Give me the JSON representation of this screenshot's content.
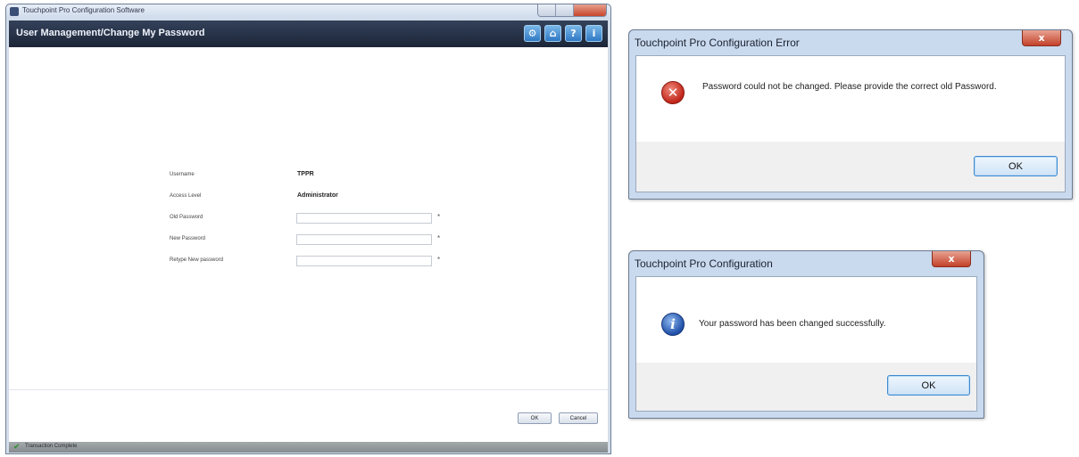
{
  "main_window": {
    "title": "Touchpoint Pro Configuration Software",
    "page_title": "User Management/Change My Password",
    "header_icons": [
      {
        "name": "settings-icon",
        "glyph": "⚙"
      },
      {
        "name": "home-icon",
        "glyph": "⌂"
      },
      {
        "name": "help-icon",
        "glyph": "?"
      },
      {
        "name": "info-icon",
        "glyph": "i"
      }
    ],
    "form": {
      "username_label": "Username",
      "username_value": "TPPR",
      "access_level_label": "Access Level",
      "access_level_value": "Administrator",
      "old_password_label": "Old Password",
      "old_password_value": "",
      "new_password_label": "New Password",
      "new_password_value": "",
      "retype_password_label": "Retype New password",
      "retype_password_value": "",
      "required_mark": "*"
    },
    "buttons": {
      "ok": "OK",
      "cancel": "Cancel"
    },
    "status": {
      "text": "Transaction Complete",
      "icon": "check-icon",
      "color": "#2f8f2f"
    }
  },
  "error_dialog": {
    "title": "Touchpoint Pro Configuration Error",
    "close": "x",
    "message": "Password could not be changed. Please provide the correct old Password.",
    "icon": "error-icon",
    "ok": "OK"
  },
  "success_dialog": {
    "title": "Touchpoint Pro Configuration",
    "close": "x",
    "message": "Your password has been changed successfully.",
    "icon": "information-icon",
    "ok": "OK"
  },
  "colors": {
    "header_bg": "#1d2638",
    "dialog_frame": "#c9d9ee",
    "close_button": "#c4412a",
    "error_icon": "#c02418",
    "info_icon": "#1f4fa8"
  }
}
